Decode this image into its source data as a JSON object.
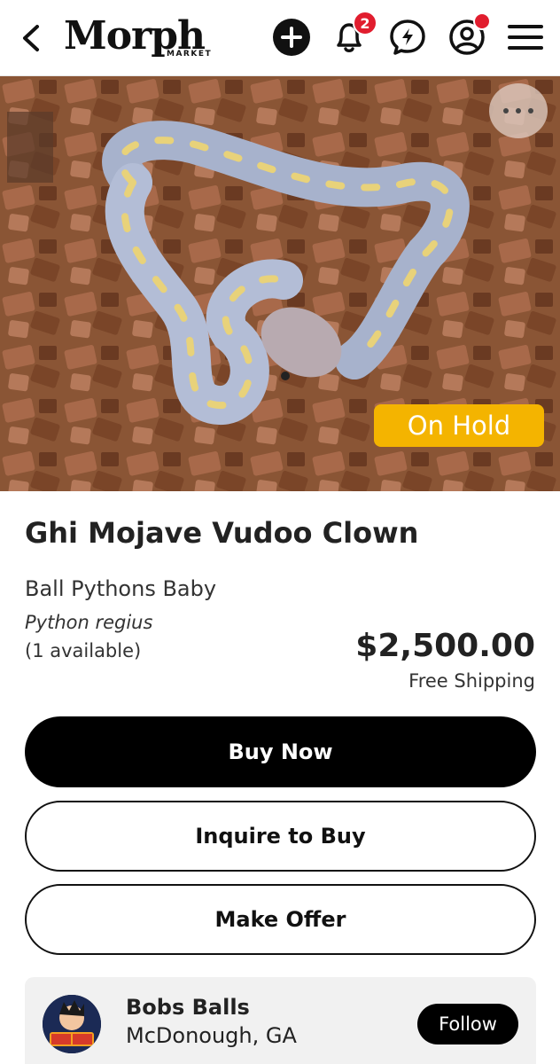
{
  "header": {
    "logo_text": "Morph",
    "logo_sub": "MARKET",
    "notification_count": "2",
    "icons": [
      "back-arrow-icon",
      "add-icon",
      "bell-icon",
      "messenger-icon",
      "account-icon",
      "menu-icon"
    ]
  },
  "listing": {
    "status_badge": "On Hold",
    "title": "Ghi Mojave Vudoo Clown",
    "category": "Ball Pythons Baby",
    "scientific_name": "Python regius",
    "availability": "(1 available)",
    "price": "$2,500.00",
    "shipping": "Free Shipping"
  },
  "actions": {
    "buy_now": "Buy Now",
    "inquire": "Inquire to Buy",
    "make_offer": "Make Offer"
  },
  "seller": {
    "name": "Bobs Balls",
    "location": "McDonough, GA",
    "follow_label": "Follow"
  },
  "colors": {
    "accent": "#000000",
    "on_hold": "#F4B400",
    "notification": "#E11D2E"
  }
}
